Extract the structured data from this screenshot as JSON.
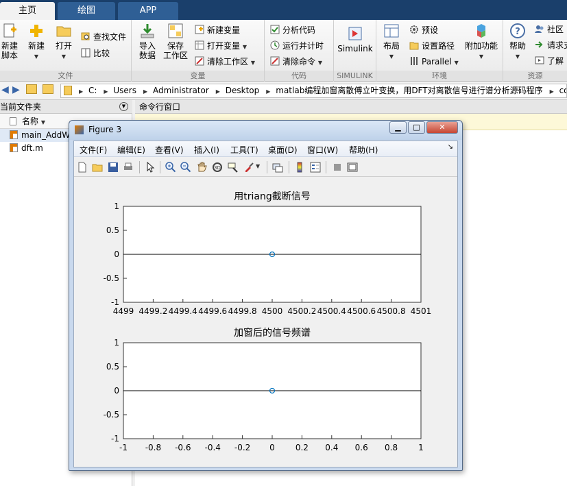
{
  "tabs": [
    {
      "label": "主页",
      "active": true
    },
    {
      "label": "绘图",
      "active": false
    },
    {
      "label": "APP",
      "active": false
    }
  ],
  "ribbon": {
    "file": {
      "group_label": "文件",
      "new_script": "新建\n脚本",
      "new": "新建",
      "open": "打开",
      "find_files": "查找文件",
      "compare": "比较"
    },
    "variable": {
      "group_label": "变量",
      "import_data": "导入\n数据",
      "save_workspace": "保存\n工作区",
      "new_variable": "新建变量",
      "open_variable": "打开变量",
      "clear_workspace": "清除工作区"
    },
    "code": {
      "group_label": "代码",
      "analyze_code": "分析代码",
      "run_and_time": "运行并计时",
      "clear_commands": "清除命令"
    },
    "simulink": {
      "group_label": "SIMULINK",
      "simulink": "Simulink"
    },
    "environment": {
      "group_label": "环境",
      "layout": "布局",
      "preferences": "预设",
      "set_path": "设置路径",
      "parallel": "Parallel",
      "add_ons": "附加功能"
    },
    "resources": {
      "group_label": "资源",
      "help": "帮助",
      "community": "社区",
      "request_support": "请求支",
      "learn": "了解"
    }
  },
  "address": {
    "crumbs": [
      "C:",
      "Users",
      "Administrator",
      "Desktop",
      "matlab编程加窗离散傅立叶变换，用DFT对离散信号进行谱分析源码程序",
      "code"
    ]
  },
  "current_folder": {
    "title": "当前文件夹",
    "column_header": "名称",
    "files": [
      {
        "name": "main_AddW",
        "type": "m-file"
      },
      {
        "name": "dft.m",
        "type": "m-file"
      }
    ]
  },
  "command_window": {
    "title": "命令行窗口"
  },
  "figure": {
    "title": "Figure 3",
    "menus": [
      "文件(F)",
      "编辑(E)",
      "查看(V)",
      "插入(I)",
      "工具(T)",
      "桌面(D)",
      "窗口(W)",
      "帮助(H)"
    ],
    "toolbar_icons": [
      "new-figure-icon",
      "open-file-icon",
      "save-icon",
      "print-icon",
      "pointer-icon",
      "zoom-in-icon",
      "zoom-out-icon",
      "pan-hand-icon",
      "rotate-3d-icon",
      "data-cursor-icon",
      "brush-icon",
      "link-plot-icon",
      "colorbar-icon",
      "legend-icon",
      "hide-plot-tools-icon",
      "show-plot-tools-icon"
    ],
    "colors": {
      "marker": "#0072bd",
      "line": "#000000"
    }
  },
  "chart_data": [
    {
      "type": "line",
      "title": "用triang截断信号",
      "xlim": [
        4499,
        4501
      ],
      "ylim": [
        -1,
        1
      ],
      "x_ticks": [
        "4499",
        "4499.2",
        "4499.4",
        "4499.6",
        "4499.8",
        "4500",
        "4500.2",
        "4500.4",
        "4500.6",
        "4500.8",
        "4501"
      ],
      "y_ticks": [
        "1",
        "0.5",
        "0",
        "-0.5",
        "-1"
      ],
      "series": [
        {
          "x": [
            4500
          ],
          "y": [
            0
          ],
          "marker": "circle"
        }
      ],
      "hline_y": 0
    },
    {
      "type": "line",
      "title": "加窗后的信号频谱",
      "xlim": [
        -1,
        1
      ],
      "ylim": [
        -1,
        1
      ],
      "x_ticks": [
        "-1",
        "-0.8",
        "-0.6",
        "-0.4",
        "-0.2",
        "0",
        "0.2",
        "0.4",
        "0.6",
        "0.8",
        "1"
      ],
      "y_ticks": [
        "1",
        "0.5",
        "0",
        "-0.5",
        "-1"
      ],
      "series": [
        {
          "x": [
            0
          ],
          "y": [
            0
          ],
          "marker": "circle"
        }
      ],
      "hline_y": 0
    }
  ]
}
